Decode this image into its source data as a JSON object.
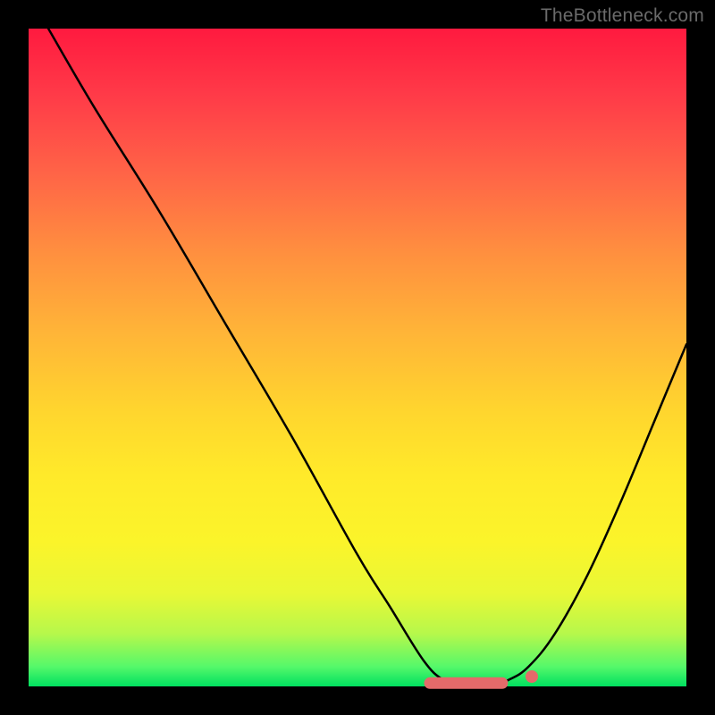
{
  "attribution": "TheBottleneck.com",
  "colors": {
    "background": "#000000",
    "curve": "#000000",
    "marker_fill": "#e46a6a",
    "marker_stroke": "#c94d4d",
    "gradient_top": "#ff1a3f",
    "gradient_bottom": "#00e060"
  },
  "chart_data": {
    "type": "line",
    "title": "",
    "xlabel": "",
    "ylabel": "",
    "xlim": [
      0,
      100
    ],
    "ylim": [
      0,
      100
    ],
    "grid": false,
    "legend": false,
    "note": "Axes carry no visible tick labels; values below are read as percent of plot width/height. y=0 is the green bottom, y=100 is the red top.",
    "series": [
      {
        "name": "curve",
        "x": [
          3,
          10,
          20,
          30,
          40,
          50,
          55,
          60,
          63,
          66,
          70,
          73,
          76,
          80,
          85,
          90,
          95,
          100
        ],
        "y": [
          100,
          88,
          72,
          55,
          38,
          20,
          12,
          4,
          1,
          0,
          0,
          1,
          3,
          8,
          17,
          28,
          40,
          52
        ]
      }
    ],
    "markers": {
      "name": "bottom-segment",
      "description": "Thick pink bar with rounded ends hugging the x-axis near the curve minimum, plus a small round dot to its right.",
      "bar": {
        "x_start": 61,
        "x_end": 72,
        "y": 0.5
      },
      "dot": {
        "x": 76.5,
        "y": 1.5
      }
    }
  }
}
